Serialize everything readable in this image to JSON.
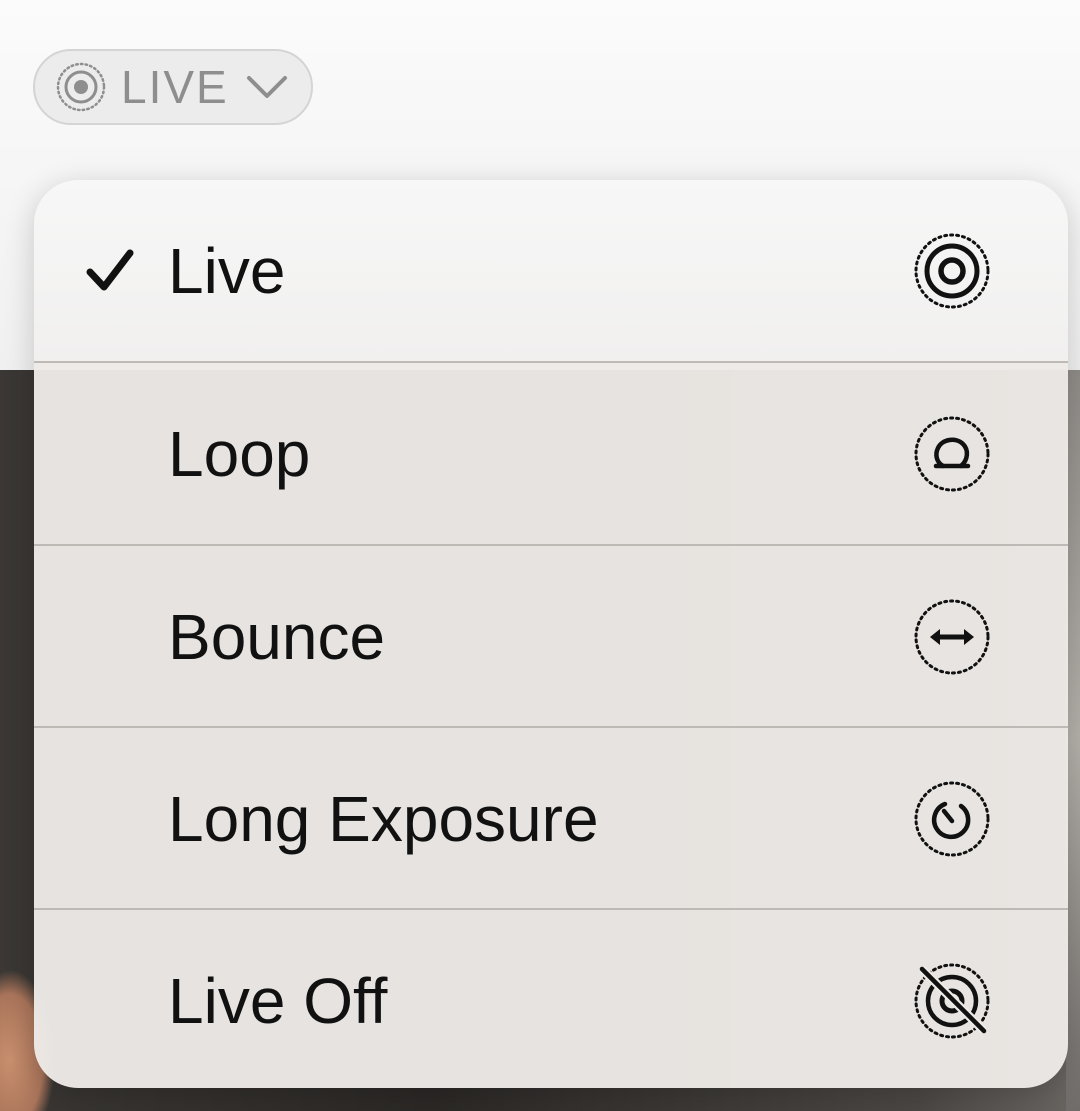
{
  "pill": {
    "label": "LIVE",
    "icon": "live-photo-icon",
    "chevron": "chevron-down-icon"
  },
  "menu": {
    "selected_index": 0,
    "check_icon": "checkmark-icon",
    "items": [
      {
        "label": "Live",
        "icon": "live-photo-icon"
      },
      {
        "label": "Loop",
        "icon": "loop-icon"
      },
      {
        "label": "Bounce",
        "icon": "bounce-icon"
      },
      {
        "label": "Long Exposure",
        "icon": "long-exposure-icon"
      },
      {
        "label": "Live Off",
        "icon": "live-off-icon"
      }
    ]
  },
  "colors": {
    "text": "#111111",
    "pill_text": "#8e8e8e",
    "divider": "#bdb9b5"
  }
}
